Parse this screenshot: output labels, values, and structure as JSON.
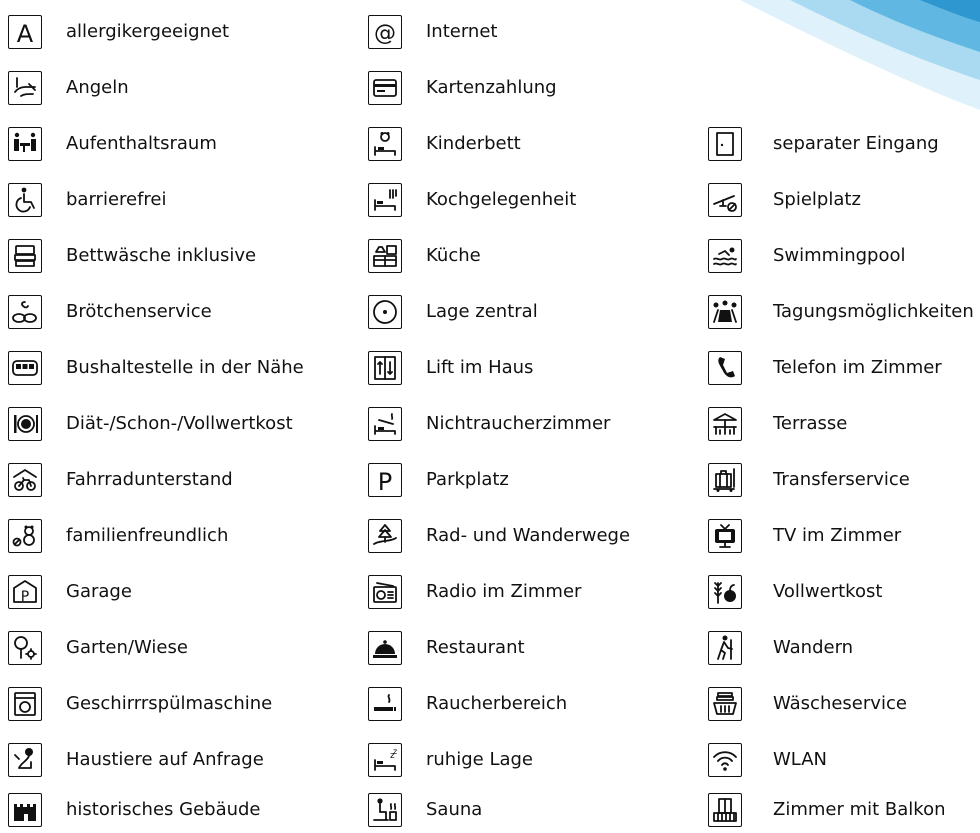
{
  "colors": {
    "text": "#111111",
    "icon": "#111111",
    "swoosh_light": "#bfe3f4",
    "swoosh_dark": "#4fb0dd"
  },
  "columns": [
    {
      "items": [
        {
          "icon": "letter-a-icon",
          "label": "allergikergeeignet"
        },
        {
          "icon": "fishing-icon",
          "label": "Angeln"
        },
        {
          "icon": "lounge-icon",
          "label": "Aufenthaltsraum"
        },
        {
          "icon": "wheelchair-icon",
          "label": "barrierefrei"
        },
        {
          "icon": "bed-linen-icon",
          "label": "Bettwäsche inklusive"
        },
        {
          "icon": "bread-rolls-icon",
          "label": "Brötchenservice"
        },
        {
          "icon": "bus-icon",
          "label": "Bushaltestelle in der Nähe"
        },
        {
          "icon": "plate-cutlery-icon",
          "label": "Diät-/Schon-/Vollwertkost"
        },
        {
          "icon": "bike-shelter-icon",
          "label": "Fahrradunterstand"
        },
        {
          "icon": "family-teddy-icon",
          "label": "familienfreundlich"
        },
        {
          "icon": "garage-icon",
          "label": "Garage"
        },
        {
          "icon": "garden-icon",
          "label": "Garten/Wiese"
        },
        {
          "icon": "dishwasher-icon",
          "label": "Geschirrrspülmaschine"
        },
        {
          "icon": "dog-icon",
          "label": "Haustiere auf Anfrage"
        },
        {
          "icon": "castle-icon",
          "label": "historisches Gebäude"
        }
      ]
    },
    {
      "items": [
        {
          "icon": "at-sign-icon",
          "label": "Internet"
        },
        {
          "icon": "credit-card-icon",
          "label": "Kartenzahlung"
        },
        {
          "icon": "crib-teddy-icon",
          "label": "Kinderbett"
        },
        {
          "icon": "bed-cutlery-icon",
          "label": "Kochgelegenheit"
        },
        {
          "icon": "kitchen-icon",
          "label": "Küche"
        },
        {
          "icon": "center-point-icon",
          "label": "Lage zentral"
        },
        {
          "icon": "elevator-icon",
          "label": "Lift im Haus"
        },
        {
          "icon": "no-smoking-bed-icon",
          "label": "Nichtraucherzimmer"
        },
        {
          "icon": "parking-icon",
          "label": "Parkplatz"
        },
        {
          "icon": "trail-icon",
          "label": "Rad- und Wanderwege"
        },
        {
          "icon": "radio-icon",
          "label": "Radio im Zimmer"
        },
        {
          "icon": "cloche-icon",
          "label": "Restaurant"
        },
        {
          "icon": "cigarette-icon",
          "label": "Raucherbereich"
        },
        {
          "icon": "sleep-bed-icon",
          "label": "ruhige Lage"
        },
        {
          "icon": "sauna-icon",
          "label": "Sauna"
        }
      ]
    },
    {
      "items": [
        {
          "icon": "door-icon",
          "label": "separater Eingang"
        },
        {
          "icon": "seesaw-icon",
          "label": "Spielplatz"
        },
        {
          "icon": "swimmer-icon",
          "label": "Swimmingpool"
        },
        {
          "icon": "meeting-icon",
          "label": "Tagungsmöglichkeiten"
        },
        {
          "icon": "telephone-icon",
          "label": "Telefon im Zimmer"
        },
        {
          "icon": "terrace-icon",
          "label": "Terrasse"
        },
        {
          "icon": "luggage-icon",
          "label": "Transferservice"
        },
        {
          "icon": "tv-icon",
          "label": "TV im Zimmer"
        },
        {
          "icon": "wheat-apple-icon",
          "label": "Vollwertkost"
        },
        {
          "icon": "hiker-icon",
          "label": "Wandern"
        },
        {
          "icon": "laundry-icon",
          "label": "Wäscheservice"
        },
        {
          "icon": "wifi-icon",
          "label": "WLAN"
        },
        {
          "icon": "balcony-icon",
          "label": "Zimmer mit Balkon"
        }
      ]
    }
  ]
}
